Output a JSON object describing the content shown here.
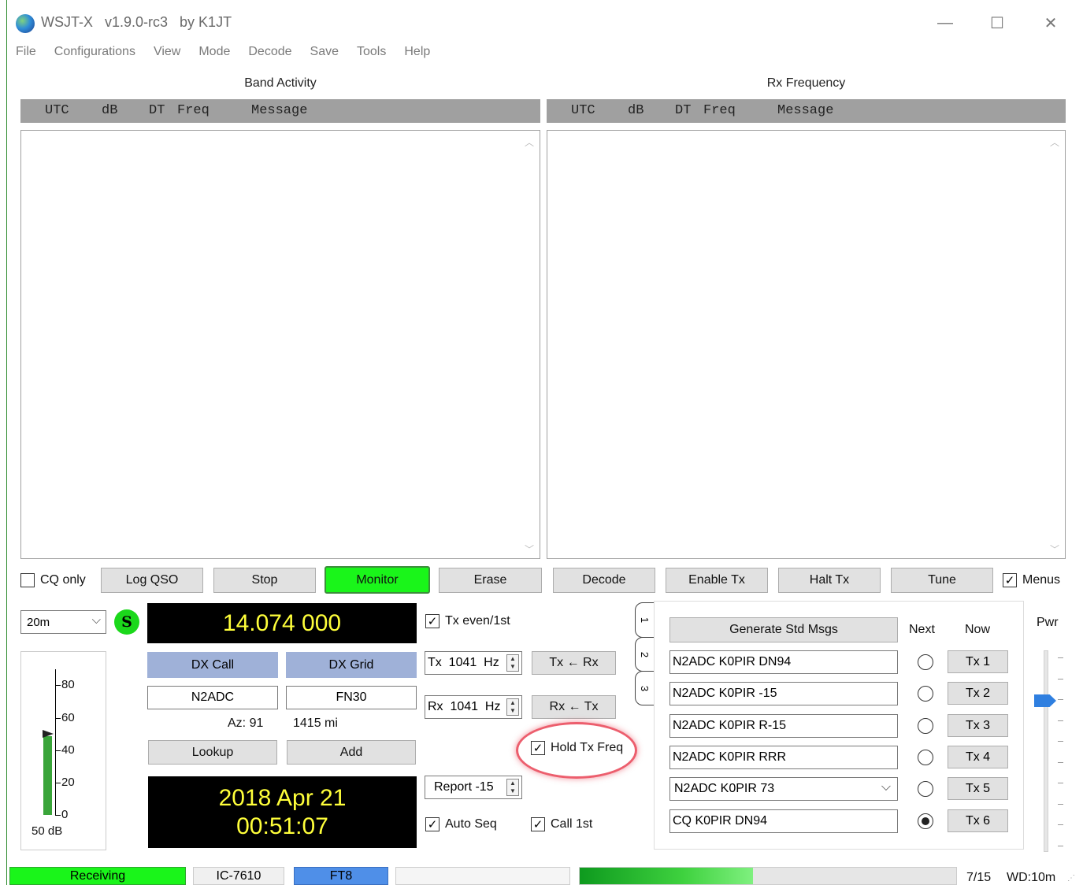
{
  "window": {
    "title": "WSJT-X   v1.9.0-rc3   by K1JT",
    "minimize_glyph": "—",
    "maximize_glyph": "☐",
    "close_glyph": "✕"
  },
  "menu": [
    "File",
    "Configurations",
    "View",
    "Mode",
    "Decode",
    "Save",
    "Tools",
    "Help"
  ],
  "band_activity": {
    "title": "Band Activity",
    "columns": {
      "utc": "UTC",
      "db": "dB",
      "dt": "DT",
      "freq": "Freq",
      "message": "Message"
    }
  },
  "rx_frequency": {
    "title": "Rx Frequency",
    "columns": {
      "utc": "UTC",
      "db": "dB",
      "dt": "DT",
      "freq": "Freq",
      "message": "Message"
    }
  },
  "controls": {
    "cq_only": "CQ only",
    "log_qso": "Log QSO",
    "stop": "Stop",
    "monitor": "Monitor",
    "erase": "Erase",
    "decode": "Decode",
    "enable_tx": "Enable Tx",
    "halt_tx": "Halt Tx",
    "tune": "Tune",
    "menus": "Menus",
    "menus_checked": true,
    "cq_only_checked": false
  },
  "band": {
    "selected": "20m",
    "s_label": "S"
  },
  "dial_frequency": "14.074 000",
  "dx": {
    "call_label": "DX Call",
    "grid_label": "DX Grid",
    "call": "N2ADC",
    "grid": "FN30",
    "azimuth": "Az: 91",
    "distance": "1415 mi",
    "lookup": "Lookup",
    "add": "Add"
  },
  "datetime": {
    "date": "2018 Apr 21",
    "time": "00:51:07"
  },
  "meter": {
    "labels": [
      "80",
      "60",
      "40",
      "20",
      "0"
    ],
    "db": "50 dB",
    "level": 0.54
  },
  "tx_options": {
    "tx_even": "Tx even/1st",
    "tx_freq": "Tx  1041  Hz",
    "rx_freq": "Rx  1041  Hz",
    "tx_from_rx": "Tx ← Rx",
    "rx_from_tx": "Rx ← Tx",
    "hold_tx_freq": "Hold Tx Freq",
    "report": "Report -15",
    "auto_seq": "Auto Seq",
    "call_1st": "Call 1st"
  },
  "tabs": [
    "1",
    "2",
    "3"
  ],
  "messages": {
    "generate": "Generate Std Msgs",
    "next": "Next",
    "now": "Now",
    "items": [
      {
        "text": "N2ADC K0PIR DN94",
        "tx": "Tx 1",
        "selected": false
      },
      {
        "text": "N2ADC K0PIR -15",
        "tx": "Tx 2",
        "selected": false
      },
      {
        "text": "N2ADC K0PIR R-15",
        "tx": "Tx 3",
        "selected": false
      },
      {
        "text": "N2ADC K0PIR RRR",
        "tx": "Tx 4",
        "selected": false
      },
      {
        "text": "N2ADC K0PIR 73",
        "tx": "Tx 5",
        "selected": false
      },
      {
        "text": "CQ K0PIR DN94",
        "tx": "Tx 6",
        "selected": true
      }
    ]
  },
  "power": {
    "label": "Pwr"
  },
  "statusbar": {
    "receiving": "Receiving",
    "rig": "IC-7610",
    "mode": "FT8",
    "progress": 0.46,
    "period": "7/15",
    "watchdog": "WD:10m"
  },
  "colors": {
    "monitor_green": "#1af51a",
    "dx_header_blue": "#9fb1d8",
    "mode_blue": "#4f8fe8",
    "lcd_text": "#ffff3a"
  }
}
